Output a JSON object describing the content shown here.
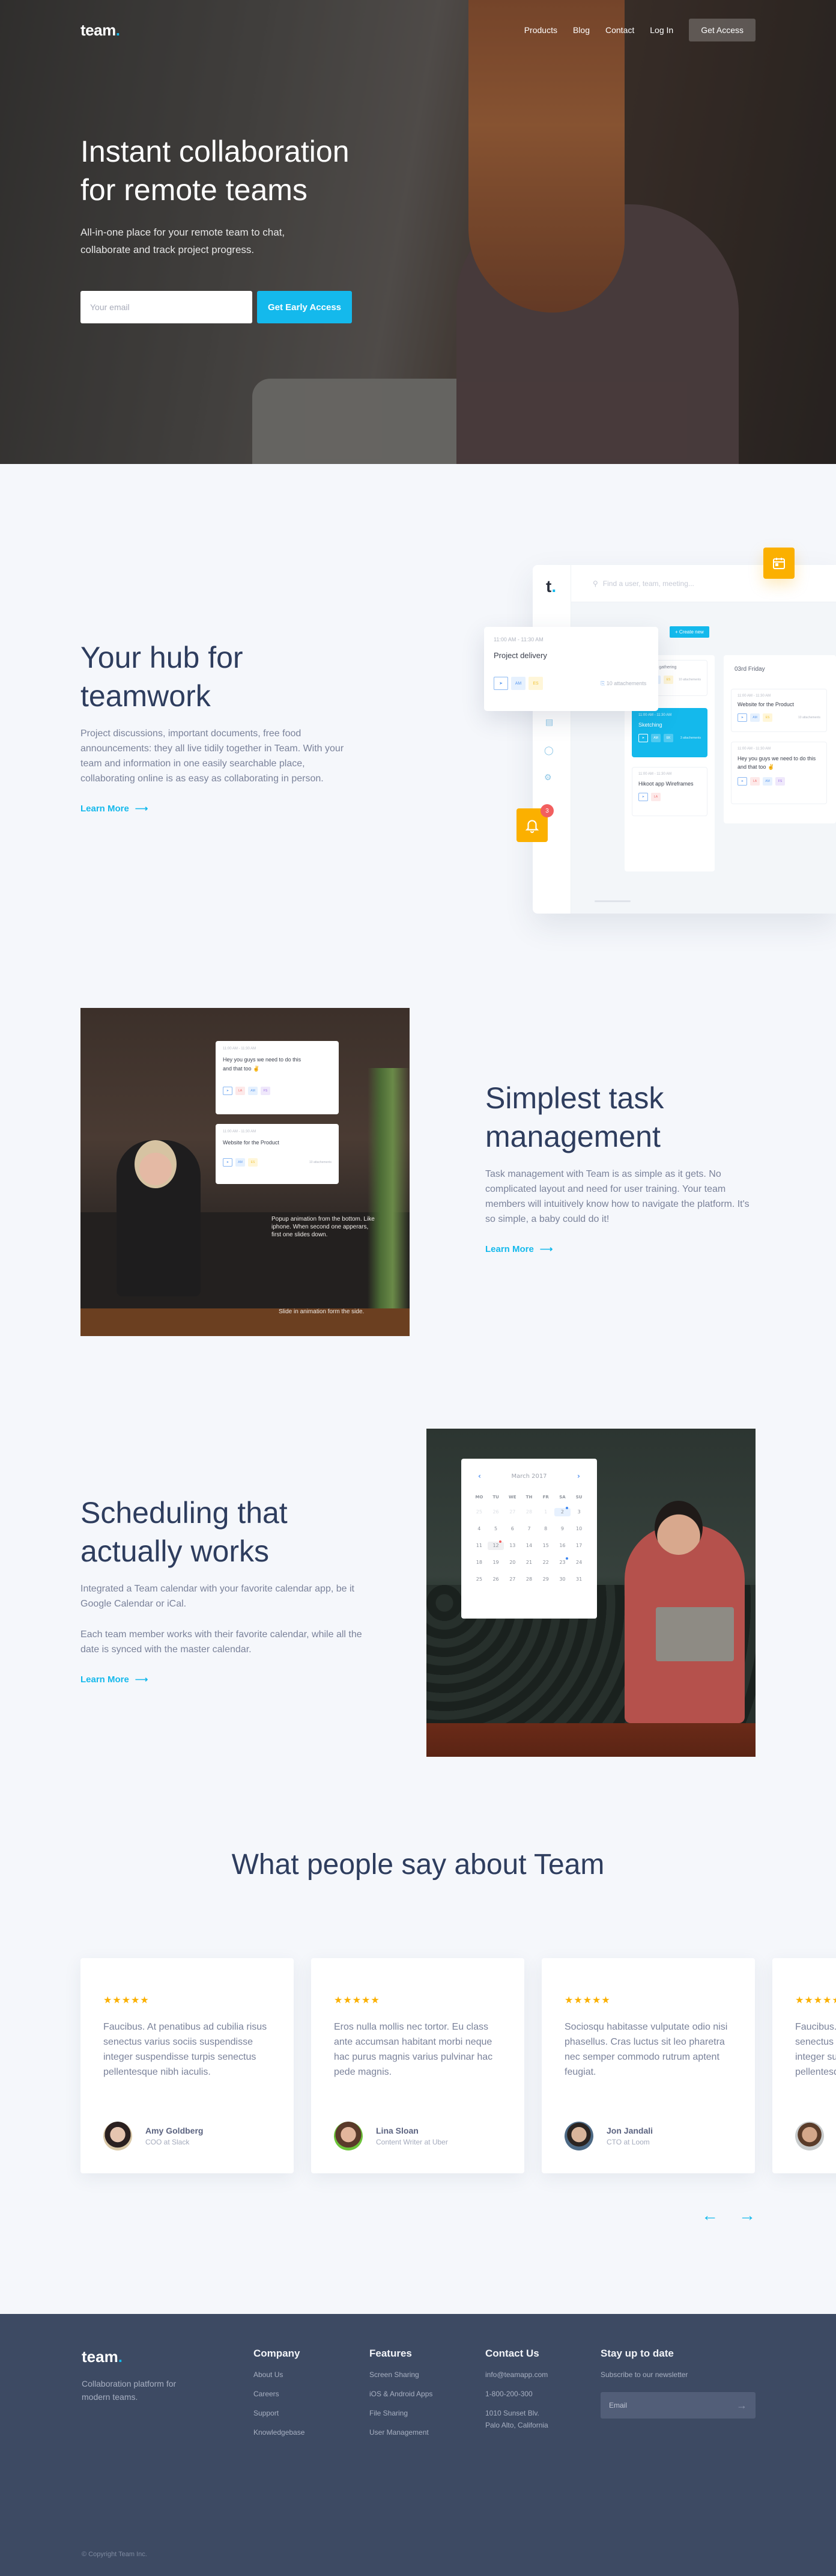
{
  "nav": {
    "logo": "team",
    "logo_dot": ".",
    "links": [
      "Products",
      "Blog",
      "Contact",
      "Log In"
    ],
    "cta": "Get Access"
  },
  "hero": {
    "title_line1": "Instant collaboration",
    "title_line2": "for remote teams",
    "subtitle": "All-in-one place for your remote team to chat, collaborate and track project progress.",
    "email_placeholder": "Your email",
    "cta": "Get Early Access"
  },
  "hub": {
    "title_line1": "Your hub for",
    "title_line2": "teamwork",
    "body": "Project discussions, important documents, free food announcements: they all live tidily together in Team. With your team and information in one easily searchable place, collaborating online is as easy as collaborating in person.",
    "learn_more": "Learn More",
    "app": {
      "logo": "t",
      "search_placeholder": "Find a user, team, meeting...",
      "create_button": "+ Create new",
      "day_title": "03rd Friday",
      "popup": {
        "time": "11:00 AM - 11:30 AM",
        "title": "Project delivery",
        "tags": [
          "AM",
          "ES"
        ],
        "attachments": "10 attachements"
      },
      "col1_cards": [
        {
          "time": "",
          "title": "Inspiration gathering",
          "tags": [
            "AM",
            "ES"
          ],
          "attachments": "10 attachements",
          "active": false
        },
        {
          "time": "11:00 AM - 11:30 AM",
          "title": "Sketching",
          "tags": [
            "AM",
            "EK"
          ],
          "attachments": "3 attachements",
          "active": true
        },
        {
          "time": "11:00 AM - 11:30 AM",
          "title": "Hikoot app Wireframes",
          "tags": [
            "LA"
          ],
          "attachments": "",
          "active": false
        }
      ],
      "col2_cards": [
        {
          "time": "11:00 AM - 11:30 AM",
          "title": "Website for the Product",
          "tags": [
            "AM",
            "ES"
          ],
          "attachments": "10 attachements"
        },
        {
          "time": "11:00 AM - 11:30 AM",
          "title": "Hey you guys we need to do this and that too ✌",
          "tags": [
            "LA",
            "AM",
            "FS"
          ],
          "attachments": ""
        }
      ],
      "notification_count": "3"
    }
  },
  "task": {
    "title_line1": "Simplest task",
    "title_line2": "management",
    "body": "Task management with Team is as simple as it gets. No complicated layout and need for user training. Your team members will intuitively know how to navigate the platform. It's so simple, a baby could do it!",
    "learn_more": "Learn More",
    "cards": [
      {
        "time": "11:00 AM - 11:30 AM",
        "message": "Hey you guys we need to do this and that too ✌",
        "tags": [
          "LA",
          "AM",
          "FS"
        ],
        "attachments": ""
      },
      {
        "time": "11:00 AM - 11:30 AM",
        "message": "Website for the Product",
        "tags": [
          "AM",
          "ES"
        ],
        "attachments": "10 attachements"
      }
    ],
    "note_popup": "Popup animation from the bottom. Like iphone. When second one apperars, first one slides down.",
    "note_slide": "Slide in animation form the side."
  },
  "schedule": {
    "title_line1": "Scheduling that",
    "title_line2": "actually works",
    "body1": "Integrated a Team calendar with your favorite calendar app, be it Google Calendar or iCal.",
    "body2": "Each team member works with their favorite calendar, while all the date is synced with the master calendar.",
    "learn_more": "Learn More",
    "calendar": {
      "month": "March 2017",
      "weekdays": [
        "MO",
        "TU",
        "WE",
        "TH",
        "FR",
        "SA",
        "SU"
      ],
      "days": [
        {
          "d": "25",
          "m": true
        },
        {
          "d": "26",
          "m": true
        },
        {
          "d": "27",
          "m": true
        },
        {
          "d": "28",
          "m": true
        },
        {
          "d": "1",
          "m": true
        },
        {
          "d": "2",
          "sel": true,
          "dot": "blue"
        },
        {
          "d": "3"
        },
        {
          "d": "4"
        },
        {
          "d": "5"
        },
        {
          "d": "6"
        },
        {
          "d": "7"
        },
        {
          "d": "8"
        },
        {
          "d": "9"
        },
        {
          "d": "10"
        },
        {
          "d": "11"
        },
        {
          "d": "12",
          "today": true,
          "dot": "red"
        },
        {
          "d": "13"
        },
        {
          "d": "14"
        },
        {
          "d": "15"
        },
        {
          "d": "16"
        },
        {
          "d": "17"
        },
        {
          "d": "18"
        },
        {
          "d": "19"
        },
        {
          "d": "20"
        },
        {
          "d": "21"
        },
        {
          "d": "22"
        },
        {
          "d": "23",
          "dot": "blue"
        },
        {
          "d": "24"
        },
        {
          "d": "25"
        },
        {
          "d": "26"
        },
        {
          "d": "27"
        },
        {
          "d": "28"
        },
        {
          "d": "29"
        },
        {
          "d": "30"
        },
        {
          "d": "31"
        }
      ]
    }
  },
  "testimonials": {
    "title": "What people say about Team",
    "items": [
      {
        "stars": "★★★★★",
        "rating": 5,
        "text": "Faucibus. At penatibus ad cubilia risus senectus varius sociis suspendisse integer suspendisse turpis senectus pellentesque nibh iaculis.",
        "name": "Amy Goldberg",
        "role": "COO at Slack"
      },
      {
        "stars": "★★★★★",
        "rating": 5,
        "text": "Eros nulla mollis nec tortor. Eu class ante accumsan habitant morbi neque hac purus magnis varius pulvinar hac pede magnis.",
        "name": "Lina Sloan",
        "role": "Content Writer at Uber"
      },
      {
        "stars": "★★★★★",
        "rating": 5,
        "text": "Sociosqu habitasse vulputate odio nisi phasellus. Cras luctus sit leo pharetra nec semper commodo rutrum aptent feugiat.",
        "name": "Jon Jandali",
        "role": "CTO at Loom"
      },
      {
        "stars": "★★★★★",
        "rating": 5,
        "text": "Faucibus. At penatibus ad cubilia risus senectus varius sociis suspendisse integer suspendisse turpis senectus pellentesque nibh iaculis.",
        "name": "",
        "role": ""
      }
    ],
    "prev": "←",
    "next": "→"
  },
  "footer": {
    "logo": "team",
    "logo_dot": ".",
    "tagline": "Collaboration platform for modern teams.",
    "company": {
      "title": "Company",
      "items": [
        "About Us",
        "Careers",
        "Support",
        "Knowledgebase"
      ]
    },
    "features": {
      "title": "Features",
      "items": [
        "Screen Sharing",
        "iOS & Android Apps",
        "File Sharing",
        "User Management"
      ]
    },
    "contact": {
      "title": "Contact Us",
      "items": [
        "info@teamapp.com",
        "1-800-200-300",
        "1010 Sunset Blv.",
        "Palo Alto, California"
      ]
    },
    "newsletter": {
      "title": "Stay up to date",
      "subtitle": "Subscribe to our newsletter",
      "placeholder": "Email"
    },
    "copyright": "© Copyright Team Inc."
  },
  "colors": {
    "accent": "#14b9ec",
    "navy": "#2e3d5e",
    "footer_bg": "#3d4a63",
    "badge": "#fbb000"
  }
}
